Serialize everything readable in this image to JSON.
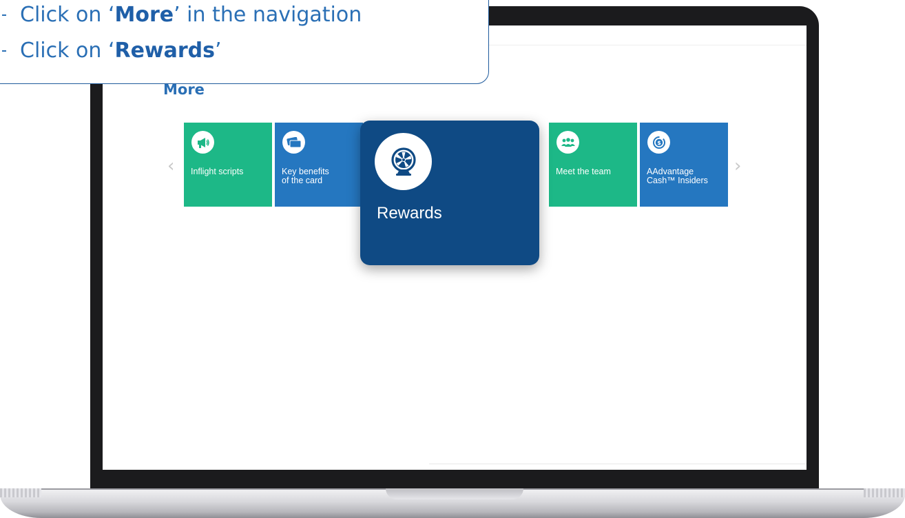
{
  "instructions": {
    "step1": {
      "prefix": "Click on ",
      "open_quote": "‘",
      "keyword": "More",
      "close_quote": "’",
      "suffix": " in the navigation"
    },
    "step2": {
      "prefix": "Click on ",
      "open_quote": "‘",
      "keyword": "Rewards",
      "close_quote": "’",
      "suffix": ""
    }
  },
  "page": {
    "title": "More"
  },
  "carousel": {
    "prev_arrow": "‹",
    "next_arrow": "›",
    "tiles": [
      {
        "label": "Inflight scripts",
        "icon": "megaphone-icon",
        "color": "#1db887"
      },
      {
        "label": "Key benefits\nof the card",
        "icon": "cards-icon",
        "color": "#2577c0"
      },
      {
        "label": "",
        "icon": "",
        "color": "#2d3b4c"
      },
      {
        "label": "Meet the team",
        "icon": "team-icon",
        "color": "#1db887"
      },
      {
        "label": "AAdvantage\nCash™ Insiders",
        "icon": "dollar-coin-icon",
        "color": "#2577c0"
      }
    ]
  },
  "highlight": {
    "label": "Rewards",
    "icon": "prize-wheel-icon",
    "color": "#0f4a84"
  },
  "colors": {
    "accent_blue": "#2a6fb5",
    "tile_green": "#1db887",
    "tile_blue": "#2577c0",
    "highlight_navy": "#0f4a84"
  }
}
